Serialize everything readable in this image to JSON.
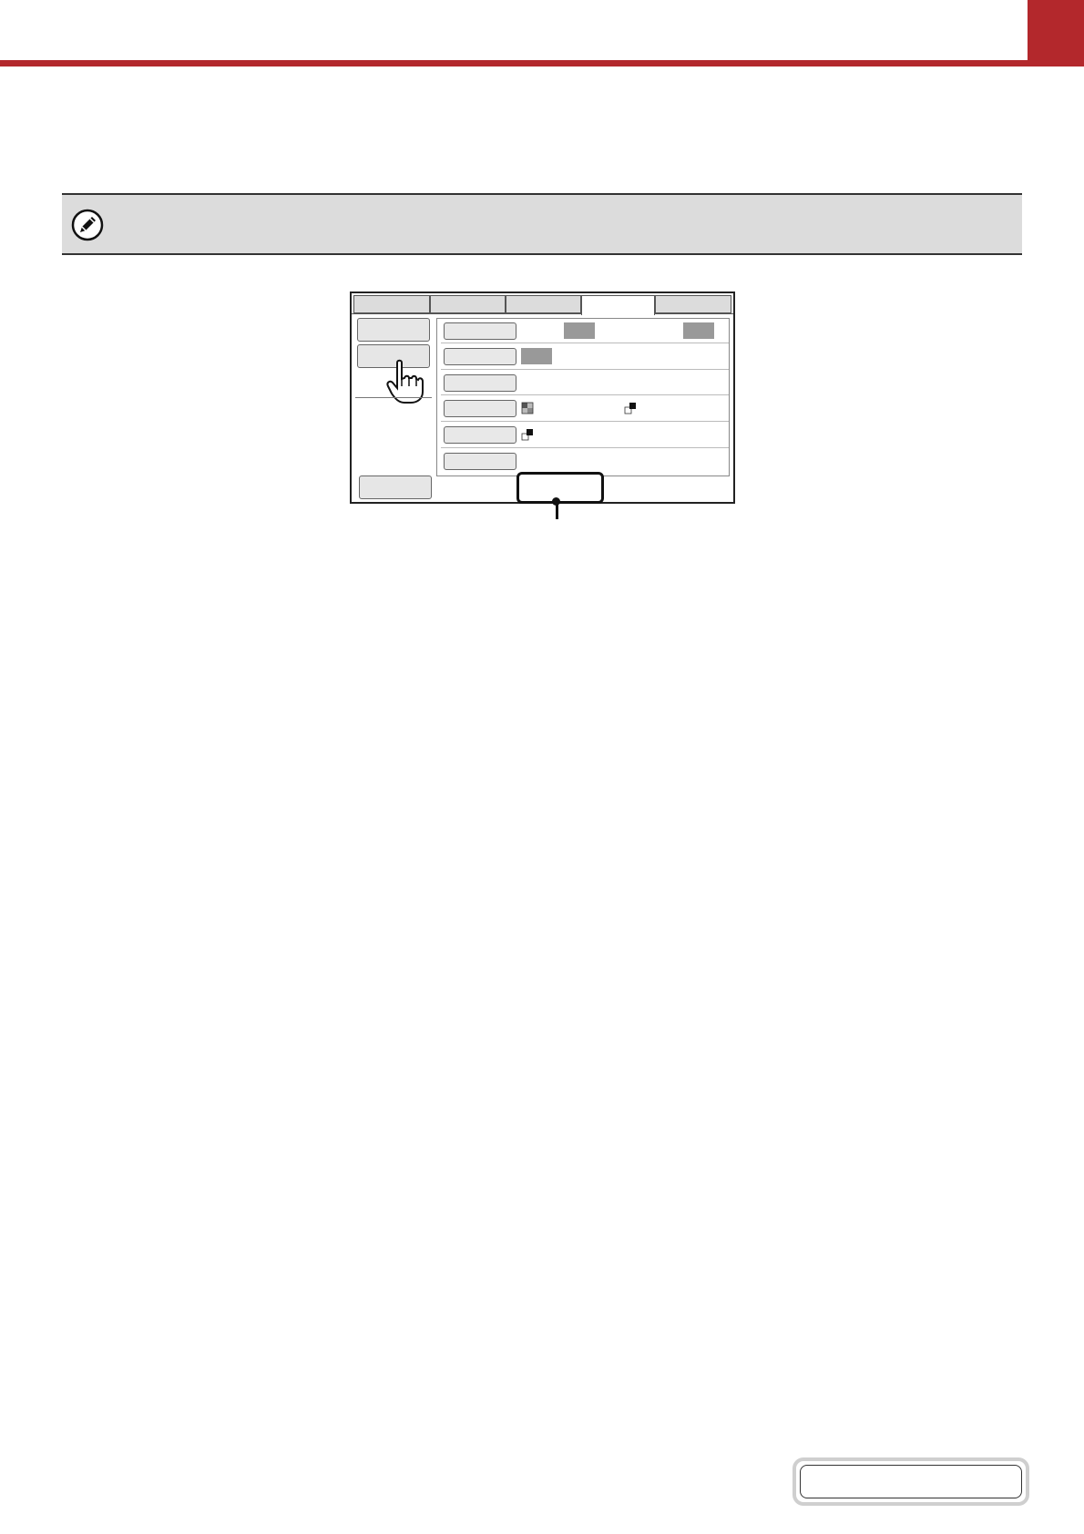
{
  "header": {
    "accent_color": "#b3282c"
  },
  "note": {
    "icon": "pencil-icon",
    "text": ""
  },
  "panel": {
    "tabs": [
      "",
      "",
      "",
      "",
      ""
    ],
    "active_tab_index": 3,
    "side_buttons": [
      "",
      ""
    ],
    "row_buttons": [
      "",
      "",
      "",
      "",
      "",
      ""
    ],
    "bottom_button": "",
    "pointer": "hand-pointer-icon",
    "callout_label": ""
  },
  "page_box": {
    "text": ""
  }
}
